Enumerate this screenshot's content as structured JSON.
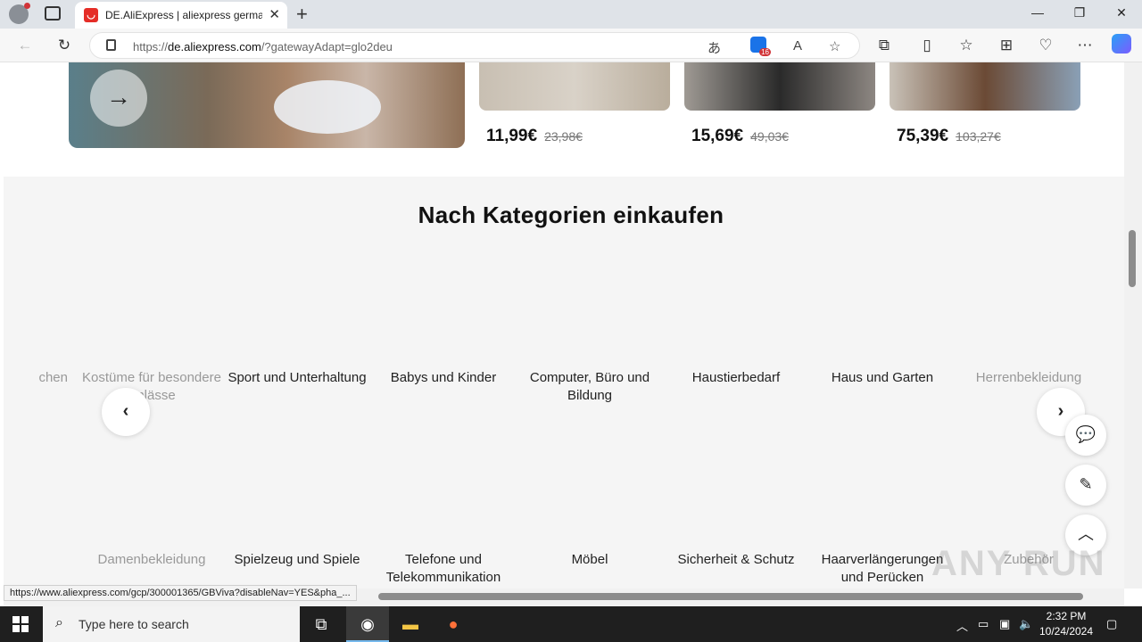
{
  "browser": {
    "tab_title": "DE.AliExpress | aliexpress german",
    "url_prefix": "https://",
    "url_host": "de.aliexpress.com",
    "url_path": "/?gatewayAdapt=glo2deu",
    "extension_badge": "16",
    "status_url": "https://www.aliexpress.com/gcp/300001365/GBViva?disableNav=YES&pha_..."
  },
  "products": [
    {
      "price": "11,99€",
      "old_price": "23,98€"
    },
    {
      "price": "15,69€",
      "old_price": "49,03€"
    },
    {
      "price": "75,39€",
      "old_price": "103,27€"
    }
  ],
  "categories": {
    "title": "Nach Kategorien einkaufen",
    "row1": [
      "chen",
      "Kostüme für besondere Anlässe",
      "Sport und Unterhaltung",
      "Babys und Kinder",
      "Computer, Büro und Bildung",
      "Haustierbedarf",
      "Haus und Garten",
      "Herrenbekleidung"
    ],
    "row2": [
      "Damenbekleidung",
      "Spielzeug und Spiele",
      "Telefone und Telekommunikation",
      "Möbel",
      "Sicherheit & Schutz",
      "Haarverlängerungen und Perücken",
      "Zubehör"
    ]
  },
  "watermark": "ANY RUN",
  "taskbar": {
    "search_placeholder": "Type here to search",
    "time": "2:32 PM",
    "date": "10/24/2024"
  },
  "colors": {
    "accent": "#e52d27",
    "section_bg": "#f5f5f5"
  }
}
